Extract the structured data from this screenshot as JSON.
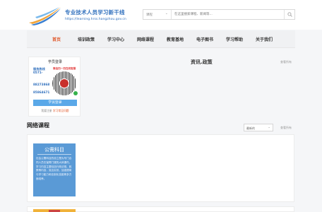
{
  "header": {
    "logo_title": "专业技术人员学习新干线",
    "logo_url": "https://learning.hrss.hangzhou.gov.cn"
  },
  "search": {
    "category": "课程",
    "placeholder": "在这里搜索课程、新闻等...",
    "icon": "search-icon"
  },
  "nav": {
    "items": [
      {
        "label": "首页",
        "active": true
      },
      {
        "label": "培训政策"
      },
      {
        "label": "学习中心"
      },
      {
        "label": "网络课程"
      },
      {
        "label": "教育基地"
      },
      {
        "label": "电子图书"
      },
      {
        "label": "学习帮助"
      },
      {
        "label": "关于我们"
      }
    ]
  },
  "login": {
    "title": "学员登录",
    "hotline_label": "服务热线",
    "hotline_prefix": "0571-",
    "qr_title": "微信扫一扫在线客服",
    "phone1": "88273868",
    "phone2": "85864671",
    "button": "学员登录",
    "help_prefix": "我要注册",
    "help_link": "学习常见问题"
  },
  "policy": {
    "title": "资讯.政策",
    "more": "查看所有"
  },
  "courses": {
    "title": "网络课程",
    "sort": "最新的",
    "more": "查看所有",
    "card": {
      "title": "公需科目",
      "description": "社会公需科目的设立是为专门合同人员在保障门课的大体课件。学习内容主要包括行政法规、政策等内容，突出实效，加强德育与学习能力和法制化技能等多方面培养。"
    }
  },
  "colors": {
    "brand": "#2f6fbd",
    "active_nav": "#e0582a",
    "button": "#5aa8e8",
    "card": "#5a9ad6"
  }
}
